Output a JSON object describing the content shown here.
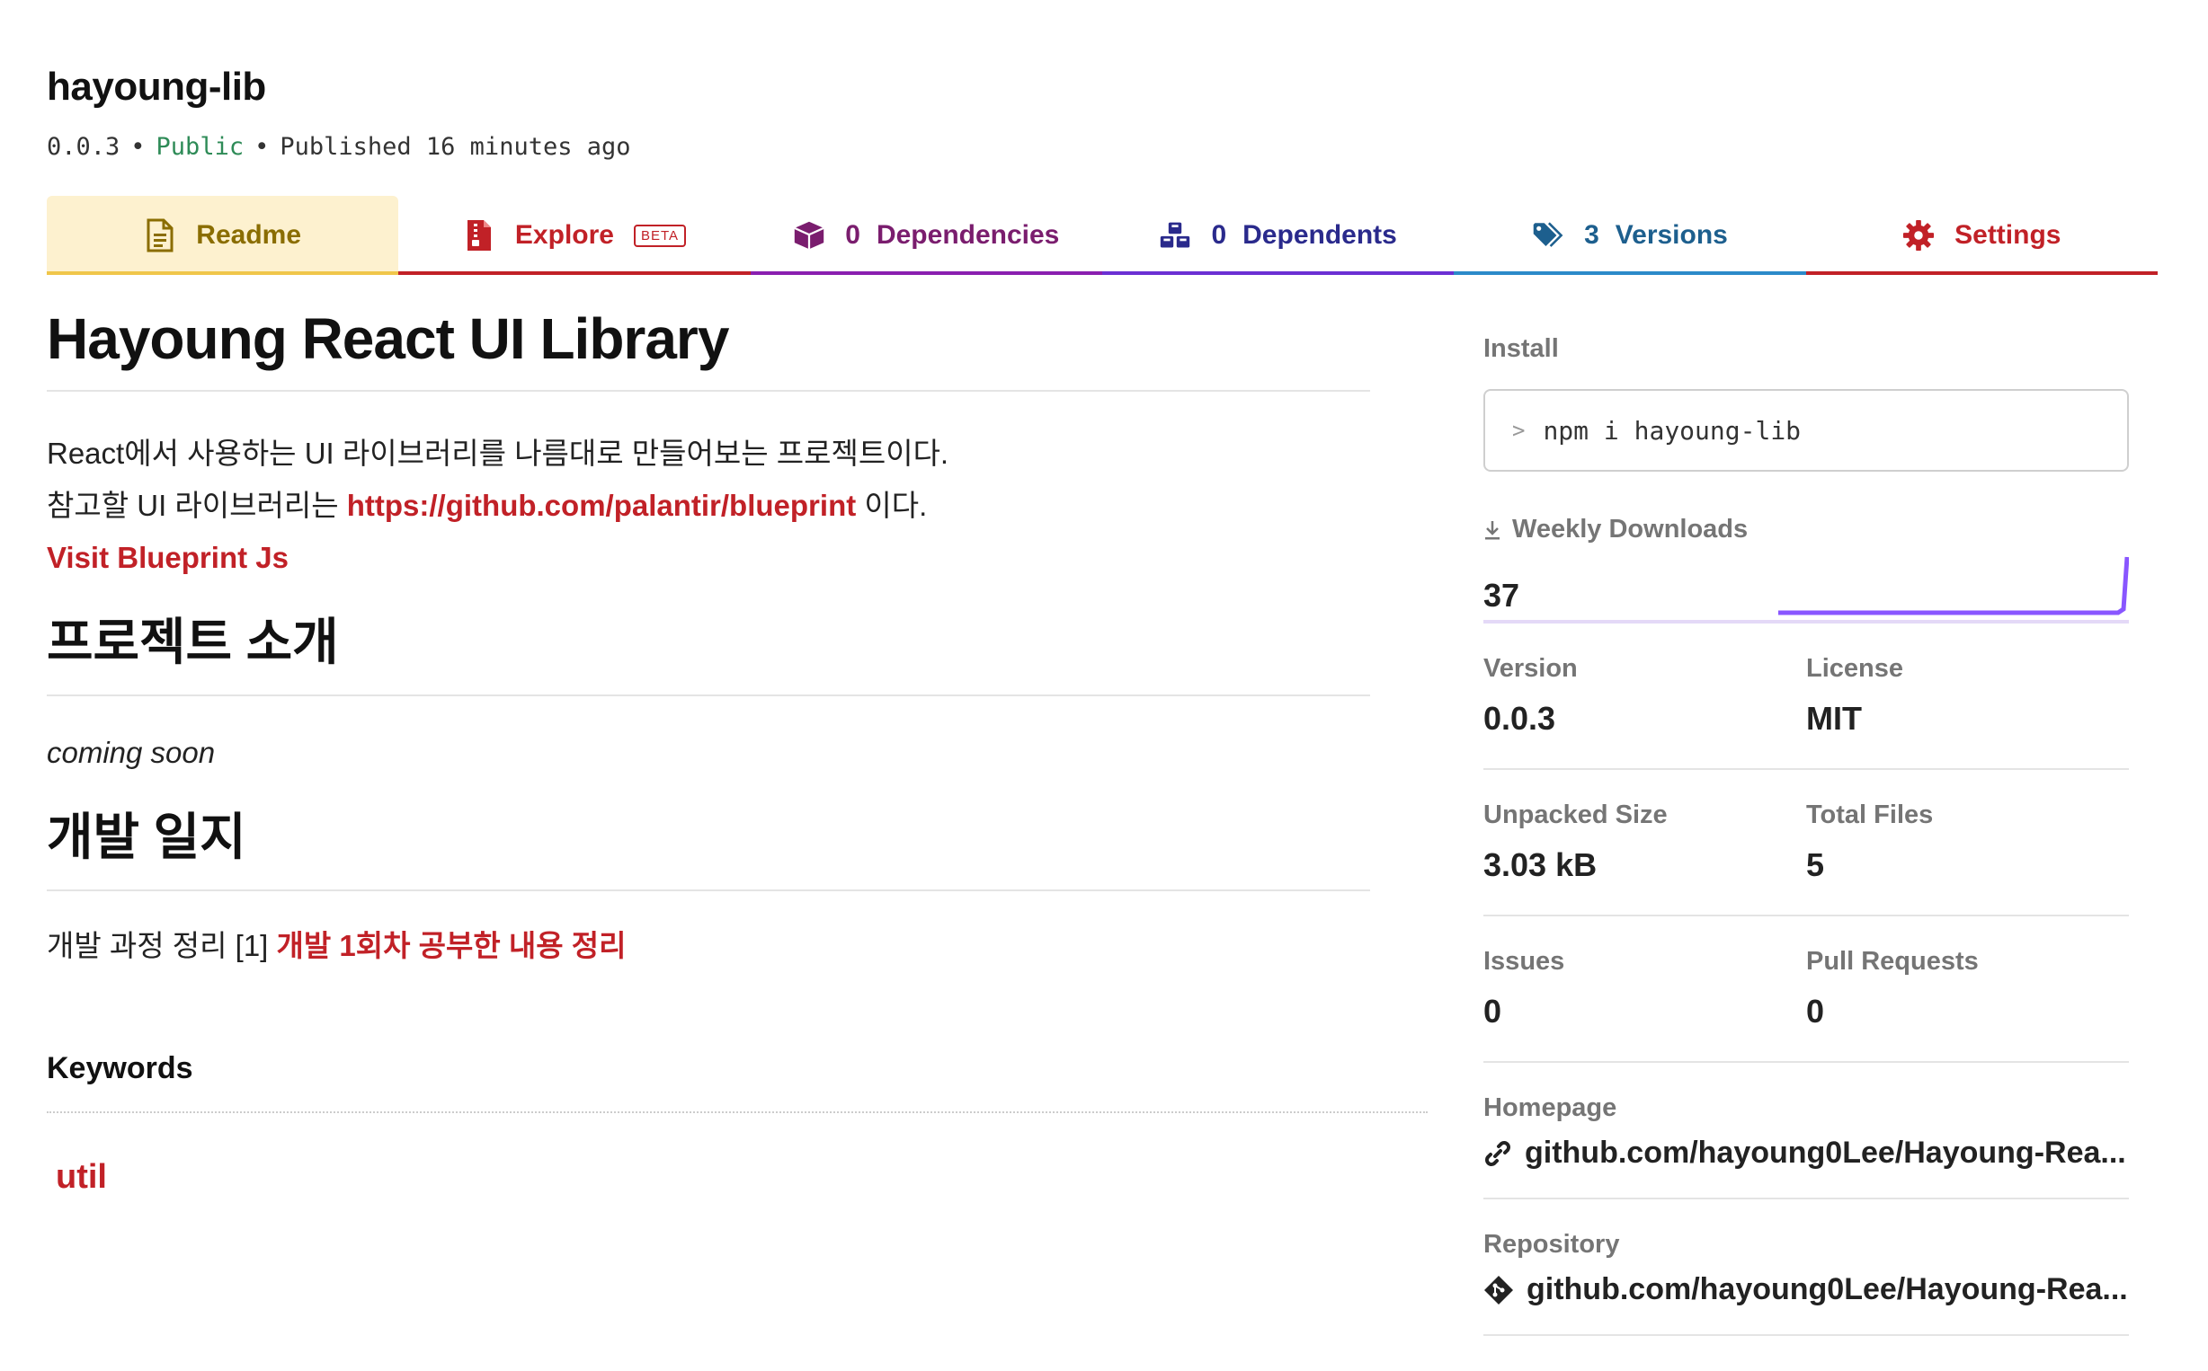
{
  "package": {
    "name": "hayoung-lib",
    "version": "0.0.3",
    "visibility": "Public",
    "published": "Published 16 minutes ago"
  },
  "tabs": {
    "readme": "Readme",
    "explore": "Explore",
    "explore_badge": "BETA",
    "dependencies_count": "0",
    "dependencies": "Dependencies",
    "dependents_count": "0",
    "dependents": "Dependents",
    "versions_count": "3",
    "versions": "Versions",
    "settings": "Settings"
  },
  "readme": {
    "title": "Hayoung React UI Library",
    "intro_line1": "React에서 사용하는 UI 라이브러리를 나름대로 만들어보는 프로젝트이다.",
    "intro_line2_prefix": "참고할 UI 라이브러리는 ",
    "intro_link": "https://github.com/palantir/blueprint",
    "intro_line2_suffix": " 이다.",
    "visit_link": "Visit Blueprint Js",
    "section1_title": "프로젝트 소개",
    "section1_body": "coming soon",
    "section2_title": "개발 일지",
    "section2_prefix": "개발 과정 정리 [1] ",
    "section2_link": "개발 1회차 공부한 내용 정리"
  },
  "keywords": {
    "title": "Keywords",
    "items": [
      "util"
    ]
  },
  "sidebar": {
    "install_label": "Install",
    "install_prompt": ">",
    "install_command": "npm i hayoung-lib",
    "weekly_downloads_label": "Weekly Downloads",
    "weekly_downloads": "37",
    "version_label": "Version",
    "version": "0.0.3",
    "license_label": "License",
    "license": "MIT",
    "unpacked_size_label": "Unpacked Size",
    "unpacked_size": "3.03 kB",
    "total_files_label": "Total Files",
    "total_files": "5",
    "issues_label": "Issues",
    "issues": "0",
    "pull_requests_label": "Pull Requests",
    "pull_requests": "0",
    "homepage_label": "Homepage",
    "homepage": "github.com/hayoung0Lee/Hayoung-Rea...",
    "repository_label": "Repository",
    "repository": "github.com/hayoung0Lee/Hayoung-Rea..."
  },
  "colors": {
    "link_red": "#c12127",
    "public_green": "#2e8b57",
    "sparkline": "#8956ff"
  }
}
